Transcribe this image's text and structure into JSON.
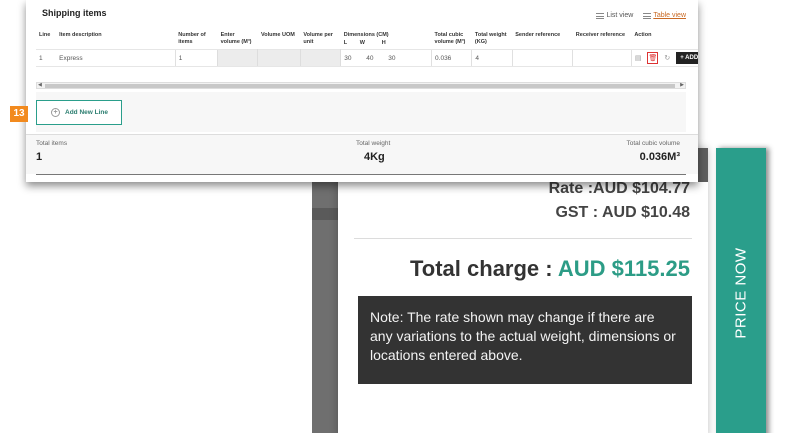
{
  "shipping": {
    "title": "Shipping items",
    "view_toggle": {
      "list": "List view",
      "table": "Table view"
    },
    "columns": {
      "line": "Line",
      "description": "Item description",
      "number": "Number of items",
      "volume": "Enter volume (M³)",
      "uom": "Volume UOM",
      "per_unit": "Volume per unit",
      "dims": "Dimensions (CM)",
      "dim_l": "L",
      "dim_w": "W",
      "dim_h": "H",
      "cubic": "Total cubic volume (M³)",
      "weight": "Total weight (KG)",
      "sender": "Sender reference",
      "receiver": "Receiver reference",
      "action": "Action"
    },
    "row": {
      "line": "1",
      "description": "Express",
      "number": "1",
      "volume": "",
      "uom": "",
      "per_unit": "",
      "l": "30",
      "w": "40",
      "h": "30",
      "cubic": "0.036",
      "weight": "4",
      "sender": "",
      "receiver": ""
    },
    "actions": {
      "add_label": "+ ADD"
    },
    "add_line_label": "Add New Line",
    "step_badge": "13",
    "totals": {
      "items_label": "Total items",
      "items_value": "1",
      "weight_label": "Total weight",
      "weight_value": "4Kg",
      "cubic_label": "Total cubic volume",
      "cubic_value": "0.036M³"
    }
  },
  "pricing": {
    "rate": "Rate :AUD $104.77",
    "gst": "GST : AUD $10.48",
    "total_label": "Total charge : ",
    "total_value": "AUD $115.25",
    "note": "Note: The rate shown may change if there are any variations to the actual weight, dimensions or locations entered above.",
    "price_now": "PRICE NOW",
    "accent_color": "#2a9e8b"
  }
}
